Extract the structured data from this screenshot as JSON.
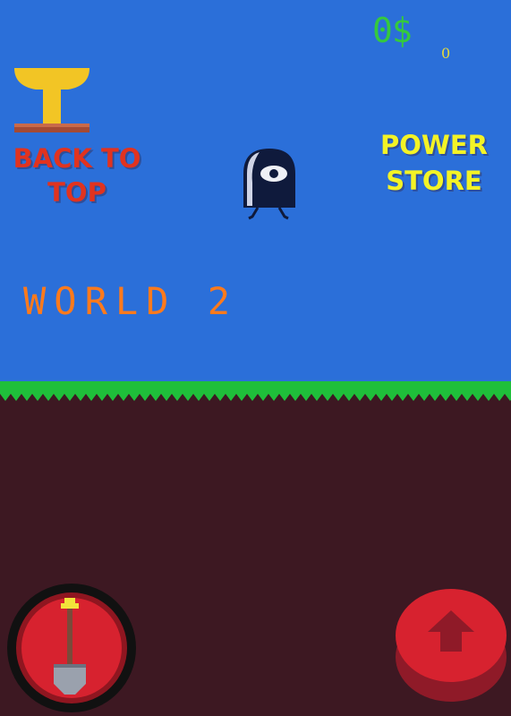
{
  "hud": {
    "money": "0$",
    "small_counter": "0"
  },
  "menu": {
    "back_to_top_label": "BACK TO TOP",
    "power_store_label": "POWER STORE"
  },
  "level": {
    "world_label": "WORLD 2"
  },
  "controls": {
    "dig_icon": "shovel-icon",
    "jump_icon": "up-arrow-icon"
  },
  "colors": {
    "sky": "#2b6fd9",
    "grass": "#1fbf3a",
    "dirt": "#3d1822",
    "money": "#35c93d",
    "back_to_top": "#e1331f",
    "power_store": "#f3f326",
    "world_label": "#ff7a1c",
    "button_red": "#d7222f"
  }
}
